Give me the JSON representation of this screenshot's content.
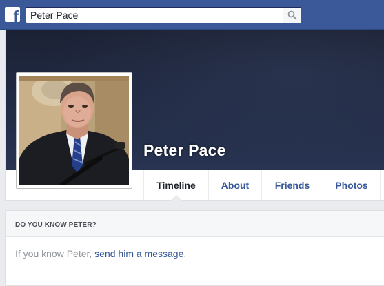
{
  "topbar": {
    "logo_glyph": "f",
    "search": {
      "value": "Peter Pace",
      "placeholder": ""
    },
    "brand_color": "#3b5998"
  },
  "profile": {
    "name": "Peter Pace",
    "tabs": [
      {
        "label": "Timeline",
        "active": true
      },
      {
        "label": "About",
        "active": false
      },
      {
        "label": "Friends",
        "active": false
      },
      {
        "label": "Photos",
        "active": false
      }
    ]
  },
  "know_card": {
    "heading": "DO YOU KNOW PETER?",
    "text_prefix": "If you know Peter, ",
    "link_text": "send him a message",
    "text_suffix": "."
  },
  "icons": [
    "facebook-logo-icon",
    "search-icon"
  ]
}
